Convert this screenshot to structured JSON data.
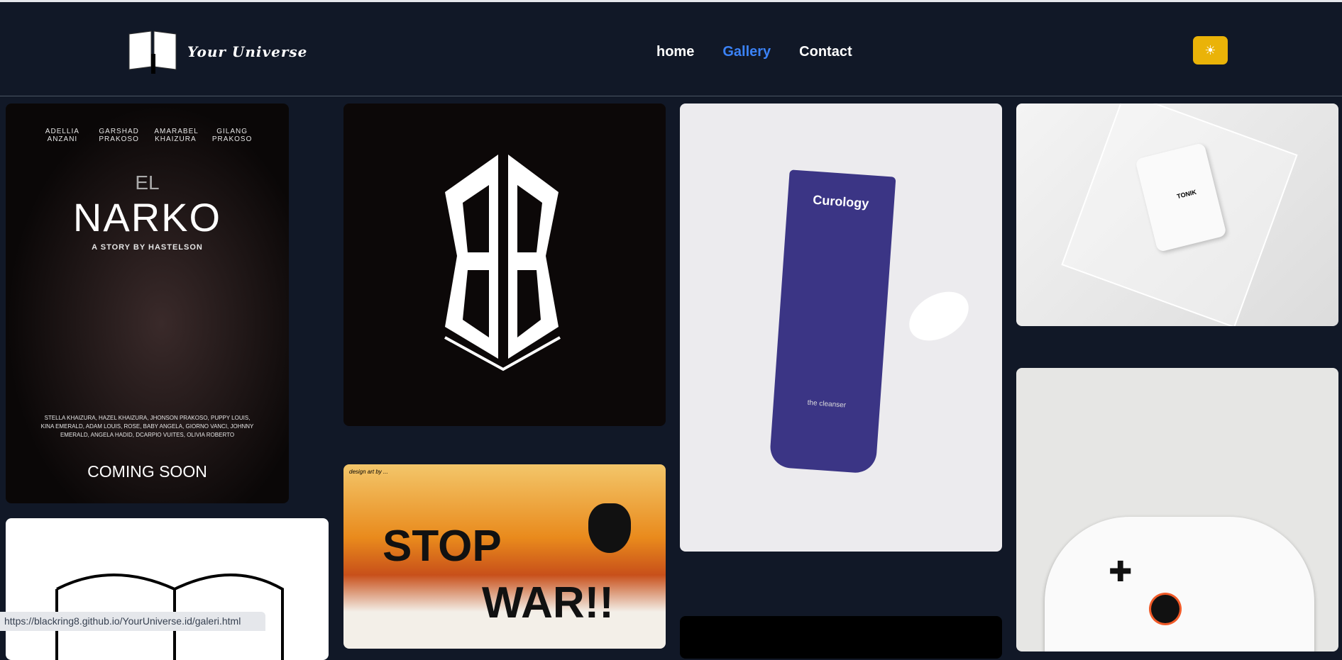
{
  "header": {
    "brand": "Your Universe",
    "nav": [
      {
        "label": "home",
        "active": false
      },
      {
        "label": "Gallery",
        "active": true
      },
      {
        "label": "Contact",
        "active": false
      }
    ],
    "theme_toggle_icon": "sun-icon",
    "theme_toggle_color": "#eab308",
    "accent": "#3b82f6"
  },
  "gallery": {
    "narko": {
      "cast": [
        "ADELLIA ANZANI",
        "GARSHAD PRAKOSO",
        "AMARABEL KHAIZURA",
        "GILANG PRAKOSO"
      ],
      "pre": "EL",
      "title": "NARKO",
      "byline": "A STORY BY HASTELSON",
      "credits": "STELLA KHAIZURA, HAZEL KHAIZURA, JHONSON PRAKOSO, PUPPY LOUIS, KINA EMERALD, ADAM LOUIS, ROSE, BABY ANGELA, GIORNO VANCI, JOHNNY EMERALD, ANGELA HADID, DCARPIO VUITES, OLIVIA ROBERTO",
      "footer": "COMING SOON"
    },
    "curology": {
      "brand": "Curology",
      "product": "the cleanser"
    },
    "tonik": {
      "label": "TONIK"
    },
    "stopwar": {
      "credit": "design art by ...",
      "line1": "STOP",
      "line2": "WAR!!"
    }
  },
  "status_url": "https://blackring8.github.io/YourUniverse.id/galeri.html"
}
